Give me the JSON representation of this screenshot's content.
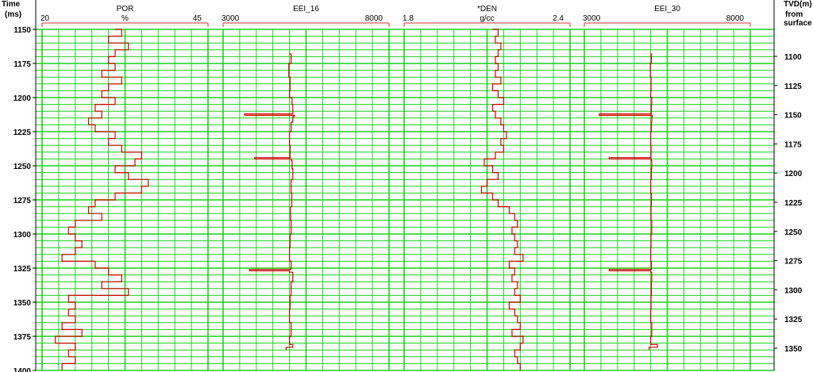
{
  "left_axis": {
    "title_line1": "Time",
    "title_line2": "(ms)",
    "ticks": [
      "1150",
      "1175",
      "1200",
      "1225",
      "1250",
      "1275",
      "1300",
      "1325",
      "1350",
      "1375",
      "1400"
    ]
  },
  "right_axis": {
    "title_line1": "TVD(m)",
    "title_line2": "from",
    "title_line3": "surface",
    "ticks": [
      "1100",
      "1125",
      "1150",
      "1175",
      "1200",
      "1225",
      "1250",
      "1275",
      "1300",
      "1325",
      "1350"
    ]
  },
  "colors": {
    "grid": "#19d219",
    "curve": "#d00000",
    "scale_bar": "#e03030",
    "background": "#ffffff"
  },
  "chart_data": {
    "type": "line",
    "y_axis": {
      "label": "Time (ms)",
      "range": [
        1150,
        1400
      ],
      "inverted": true
    },
    "y2_axis": {
      "label": "TVD(m) from surface",
      "range": [
        1080,
        1360
      ]
    },
    "grid": true,
    "tracks": [
      {
        "name": "POR",
        "unit": "%",
        "min": 20,
        "max": 45,
        "min_label": "20",
        "max_label": "45",
        "series": {
          "y": [
            1150,
            1155,
            1160,
            1165,
            1170,
            1175,
            1180,
            1185,
            1190,
            1195,
            1200,
            1205,
            1210,
            1215,
            1220,
            1225,
            1230,
            1235,
            1240,
            1245,
            1250,
            1255,
            1260,
            1265,
            1270,
            1275,
            1280,
            1285,
            1290,
            1295,
            1300,
            1305,
            1310,
            1315,
            1320,
            1325,
            1330,
            1335,
            1340,
            1345,
            1350,
            1355,
            1360,
            1365,
            1370,
            1375,
            1380,
            1385,
            1390,
            1395,
            1400
          ],
          "x": [
            31,
            32,
            30,
            33,
            31,
            30,
            31,
            29,
            32,
            30,
            29,
            31,
            28,
            29,
            27,
            28,
            31,
            30,
            32,
            35,
            34,
            31,
            33,
            36,
            35,
            31,
            28,
            27,
            29,
            25,
            24,
            25,
            26,
            25,
            23,
            28,
            30,
            32,
            29,
            33,
            24,
            25,
            24,
            25,
            23,
            26,
            22,
            25,
            24,
            25,
            23
          ]
        }
      },
      {
        "name": "EEI_16",
        "unit": "",
        "min": 3000,
        "max": 8000,
        "min_label": "3000",
        "max_label": "8000",
        "series": {
          "y": [
            1168,
            1175,
            1185,
            1195,
            1200,
            1205,
            1212,
            1213,
            1214,
            1218,
            1225,
            1235,
            1244,
            1245,
            1246,
            1252,
            1260,
            1270,
            1280,
            1290,
            1300,
            1310,
            1320,
            1326,
            1327,
            1328,
            1335,
            1345,
            1355,
            1365,
            1375,
            1381,
            1383,
            1385
          ],
          "x": [
            5000,
            5050,
            4980,
            5020,
            5000,
            5080,
            5100,
            3650,
            5150,
            5100,
            5050,
            5000,
            5020,
            3950,
            5050,
            5080,
            5100,
            5050,
            5070,
            5030,
            5050,
            5020,
            5000,
            5050,
            3800,
            5000,
            5100,
            5050,
            5020,
            5000,
            5050,
            5000,
            5100,
            4900
          ]
        }
      },
      {
        "name": "*DEN",
        "unit": "g/cc",
        "min": 1.8,
        "max": 2.4,
        "min_label": "1.8",
        "max_label": "2.4",
        "series": {
          "y": [
            1150,
            1155,
            1160,
            1165,
            1170,
            1175,
            1180,
            1185,
            1190,
            1195,
            1200,
            1205,
            1210,
            1215,
            1220,
            1225,
            1230,
            1235,
            1240,
            1245,
            1250,
            1255,
            1260,
            1265,
            1270,
            1275,
            1280,
            1285,
            1290,
            1295,
            1300,
            1305,
            1310,
            1315,
            1320,
            1325,
            1330,
            1335,
            1340,
            1345,
            1350,
            1355,
            1360,
            1365,
            1370,
            1375,
            1380,
            1385,
            1390,
            1395,
            1400
          ],
          "x": [
            2.12,
            2.14,
            2.13,
            2.15,
            2.14,
            2.13,
            2.14,
            2.13,
            2.15,
            2.12,
            2.14,
            2.16,
            2.12,
            2.13,
            2.15,
            2.16,
            2.17,
            2.15,
            2.16,
            2.13,
            2.09,
            2.12,
            2.14,
            2.1,
            2.08,
            2.12,
            2.14,
            2.18,
            2.2,
            2.21,
            2.19,
            2.2,
            2.21,
            2.2,
            2.23,
            2.18,
            2.2,
            2.19,
            2.21,
            2.2,
            2.22,
            2.18,
            2.2,
            2.21,
            2.22,
            2.19,
            2.23,
            2.22,
            2.2,
            2.21,
            2.22
          ]
        }
      },
      {
        "name": "EEI_30",
        "unit": "",
        "min": 3000,
        "max": 8000,
        "min_label": "3000",
        "max_label": "8000",
        "series": {
          "y": [
            1168,
            1175,
            1185,
            1195,
            1200,
            1205,
            1212,
            1213,
            1214,
            1218,
            1225,
            1235,
            1244,
            1245,
            1246,
            1252,
            1260,
            1270,
            1280,
            1290,
            1300,
            1310,
            1320,
            1326,
            1327,
            1328,
            1335,
            1345,
            1355,
            1365,
            1375,
            1381,
            1383,
            1385
          ],
          "x": [
            5000,
            5020,
            4990,
            5010,
            5000,
            5030,
            5020,
            3450,
            5050,
            5030,
            5020,
            5000,
            5010,
            3750,
            5020,
            5030,
            5020,
            5000,
            5020,
            5010,
            5030,
            5010,
            5000,
            5020,
            3750,
            5000,
            5030,
            5020,
            5010,
            5000,
            5030,
            5000,
            5200,
            4950
          ]
        }
      }
    ]
  }
}
